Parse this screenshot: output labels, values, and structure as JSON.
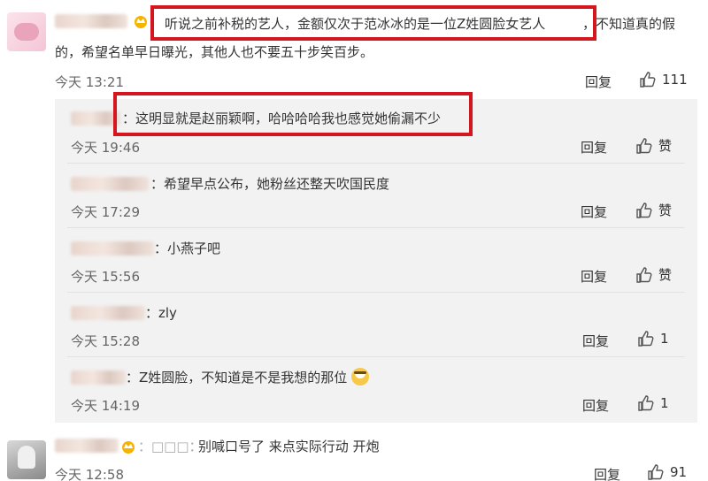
{
  "top_comment": {
    "text_line1_pre": "听说之前补税的艺人，金额仅次于范冰冰的是一位Z姓圆脸女艺人",
    "text_line1_post": "，不知道真的假",
    "text_line2": "的，希望名单早日曝光，其他人也不要五十步笑百步。",
    "time": "今天 13:21",
    "reply": "回复",
    "likes": "111"
  },
  "replies": [
    {
      "text": "：这明显就是赵丽颖啊，哈哈哈哈我也感觉她偷漏不少",
      "time": "今天 19:46",
      "reply": "回复",
      "likes": "赞"
    },
    {
      "text": "：希望早点公布，她粉丝还整天吹国民度",
      "time": "今天 17:29",
      "reply": "回复",
      "likes": "赞"
    },
    {
      "text": "：小燕子吧",
      "time": "今天 15:56",
      "reply": "回复",
      "likes": "赞"
    },
    {
      "text": "：zly",
      "time": "今天 15:28",
      "reply": "回复",
      "likes": "1"
    },
    {
      "text": "：Z姓圆脸，不知道是不是我想的那位",
      "time": "今天 14:19",
      "reply": "回复",
      "likes": "1"
    }
  ],
  "bottom_comment": {
    "mention": "：□□□：",
    "text": "别喊口号了 来点实际行动 开炮",
    "time": "今天 12:58",
    "reply": "回复",
    "likes": "91"
  },
  "colors": {
    "highlight_box": "#d4171f",
    "sub_panel_bg": "#f2f2f2"
  },
  "icons": [
    "thumbs-up-icon",
    "crown-badge-icon",
    "laughing-emoji-icon"
  ]
}
